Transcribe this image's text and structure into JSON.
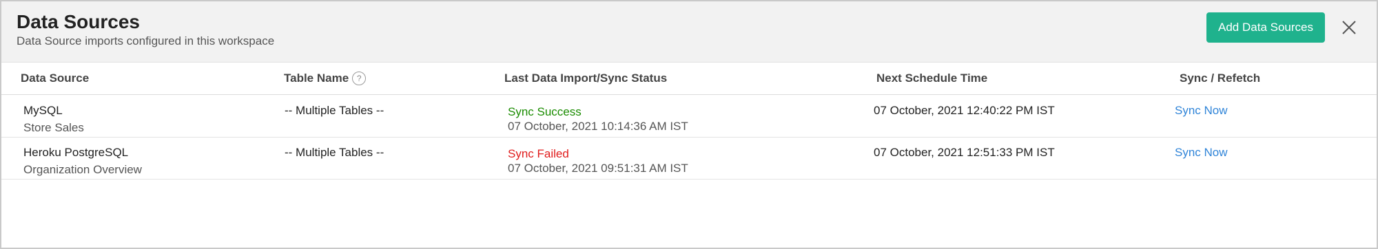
{
  "header": {
    "title": "Data Sources",
    "subtitle": "Data Source imports configured in this workspace",
    "add_button": "Add Data Sources",
    "close_icon": "close-icon"
  },
  "colors": {
    "accent": "#1fb28d",
    "success": "#1a8c00",
    "failure": "#e01b1b",
    "link": "#2f84d8"
  },
  "table": {
    "columns": {
      "data_source": "Data Source",
      "table_name": "Table Name",
      "status": "Last Data Import/Sync Status",
      "next_schedule": "Next Schedule Time",
      "sync": "Sync / Refetch"
    },
    "help_icon": "?",
    "rows": [
      {
        "source": "MySQL",
        "description": "Store Sales",
        "table_name": "-- Multiple Tables --",
        "status": "Sync Success",
        "status_time": "07 October, 2021 10:14:36 AM IST",
        "next_schedule": "07 October, 2021 12:40:22 PM IST",
        "action": "Sync Now"
      },
      {
        "source": "Heroku PostgreSQL",
        "description": "Organization Overview",
        "table_name": "-- Multiple Tables --",
        "status": "Sync Failed",
        "status_time": "07 October, 2021 09:51:31 AM IST",
        "next_schedule": "07 October, 2021 12:51:33 PM IST",
        "action": "Sync Now"
      }
    ]
  }
}
